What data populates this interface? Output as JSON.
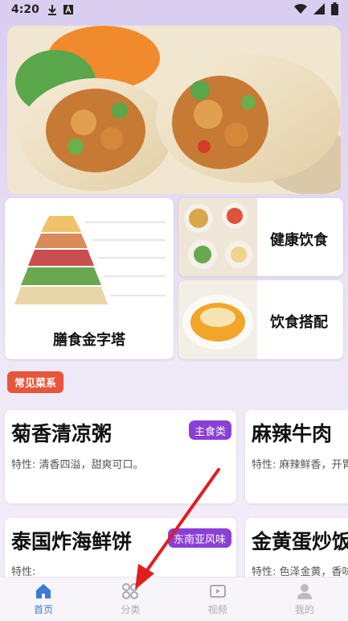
{
  "status_bar": {
    "time": "4:20"
  },
  "banner": {
    "alt": "wrap-photo"
  },
  "features": {
    "pyramid": {
      "label": "膳食金字塔"
    },
    "healthy": {
      "label": "健康饮食"
    },
    "match": {
      "label": "饮食搭配"
    }
  },
  "section": {
    "title": "常见菜系"
  },
  "recipes": [
    {
      "title": "菊香清凉粥",
      "desc": "特性: 清香四溢，甜爽可口。",
      "badge": "主食类"
    },
    {
      "title": "麻辣牛肉",
      "desc": "特性: 麻辣鲜香，开胃"
    },
    {
      "title": "泰国炸海鲜饼",
      "desc": "特性:",
      "badge": "东南亚风味"
    },
    {
      "title": "金黄蛋炒饭",
      "desc": "特性: 色泽金黄，香味"
    }
  ],
  "nav": [
    {
      "label": "首页",
      "active": true
    },
    {
      "label": "分类"
    },
    {
      "label": "视频"
    },
    {
      "label": "我的"
    }
  ],
  "colors": {
    "accent": "#3a7bd5",
    "section_tag": "#e8553b",
    "badge": "#8a3fd6",
    "arrow": "#e01e1e"
  }
}
